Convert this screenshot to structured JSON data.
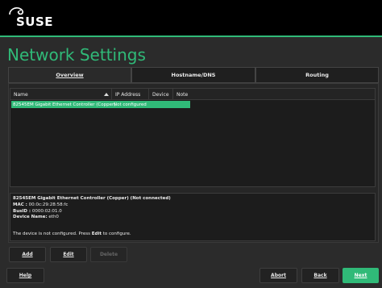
{
  "header": {
    "logo_text": "SUSE",
    "accent_color": "#30ba78"
  },
  "page": {
    "title": "Network Settings"
  },
  "tabs": [
    {
      "label": "Overview",
      "active": true
    },
    {
      "label": "Hostname/DNS",
      "active": false
    },
    {
      "label": "Routing",
      "active": false
    }
  ],
  "table": {
    "columns": [
      "Name",
      "IP Address",
      "Device",
      "Note"
    ],
    "sort_column": "Name",
    "rows": [
      {
        "name": "82545EM Gigabit Ethernet Controller (Copper)",
        "ip": "Not configured",
        "device": "",
        "note": "",
        "selected": true
      }
    ]
  },
  "details": {
    "heading": "82545EM Gigabit Ethernet Controller (Copper) (Not connected)",
    "mac_label": "MAC :",
    "mac_value": "00:0c:29:28:58:fc",
    "busid_label": "BusID :",
    "busid_value": "0000:02:01.0",
    "device_label": "Device Name:",
    "device_value": "eth0",
    "status_prefix": "The device is not configured. Press ",
    "status_keyword": "Edit",
    "status_suffix": " to configure."
  },
  "actions": {
    "add": "Add",
    "edit": "Edit",
    "delete": "Delete"
  },
  "footer": {
    "help": "Help",
    "abort": "Abort",
    "back": "Back",
    "next": "Next"
  }
}
